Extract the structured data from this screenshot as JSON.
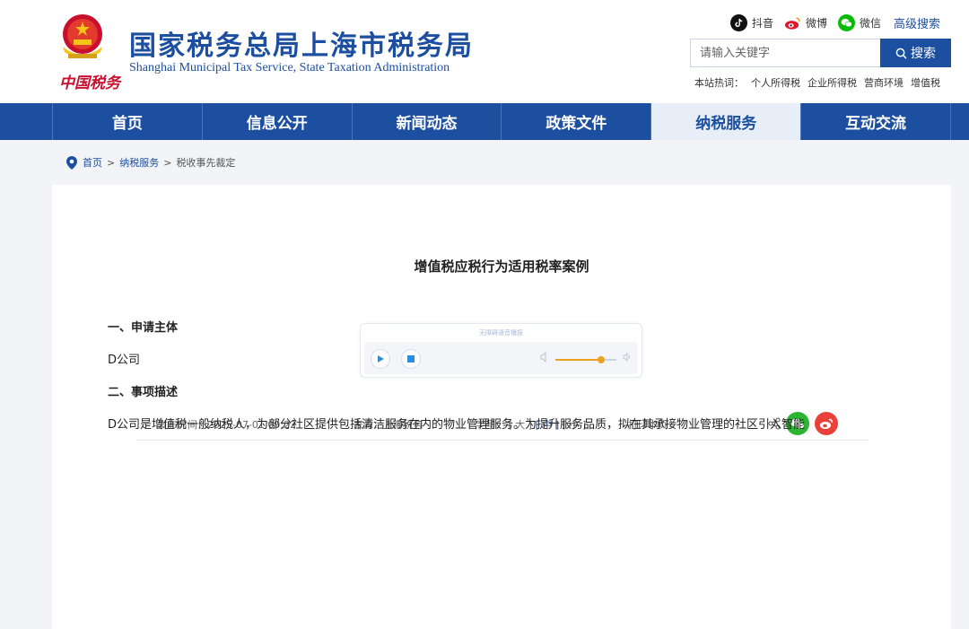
{
  "header": {
    "title": "国家税务总局上海市税务局",
    "subtitle": "Shanghai Municipal Tax Service, State Taxation Administration",
    "emblem_text": "中国税务",
    "social": [
      {
        "label": "抖音",
        "icon": "douyin-icon",
        "color": "#111111"
      },
      {
        "label": "微博",
        "icon": "weibo-icon",
        "color": "#e6162d"
      },
      {
        "label": "微信",
        "icon": "wechat-icon",
        "color": "#09bb07"
      }
    ],
    "advanced_search": "高级搜索",
    "search": {
      "placeholder": "请输入关键字",
      "button": "搜索"
    },
    "hot": {
      "label": "本站热词：",
      "items": [
        "个人所得税",
        "企业所得税",
        "营商环境",
        "增值税"
      ]
    }
  },
  "nav": {
    "items": [
      "首页",
      "信息公开",
      "新闻动态",
      "政策文件",
      "纳税服务",
      "互动交流"
    ],
    "active": "纳税服务"
  },
  "breadcrumb": {
    "home": "首页",
    "sep": ">",
    "section": "纳税服务",
    "current": "税收事先裁定"
  },
  "article": {
    "title": "增值税应税行为适用税率案例",
    "player": {
      "label": "无障碍语音播报",
      "volume": 0.75
    },
    "meta": {
      "publish": "发布时间：2025-07-01 09:22",
      "source": "来源：上海税务",
      "font_label": "字号：",
      "font_large": "[ 大 ]",
      "font_medium": "[ 中 ]",
      "font_small": "[ 小 ]",
      "print": "打印本页"
    },
    "paragraphs": [
      {
        "text": "一、申请主体",
        "heading": true
      },
      {
        "text": "D公司",
        "heading": false
      },
      {
        "text": "二、事项描述",
        "heading": true
      },
      {
        "text": "D公司是增值税一般纳税人，为部分社区提供包括清洁服务在内的物业管理服务。为提升服务品质，拟在其承接物业管理的社区引入智能",
        "heading": false
      }
    ]
  },
  "colors": {
    "brand": "#1c4fa0",
    "accent": "#c8102e",
    "volume": "#f0a020"
  }
}
